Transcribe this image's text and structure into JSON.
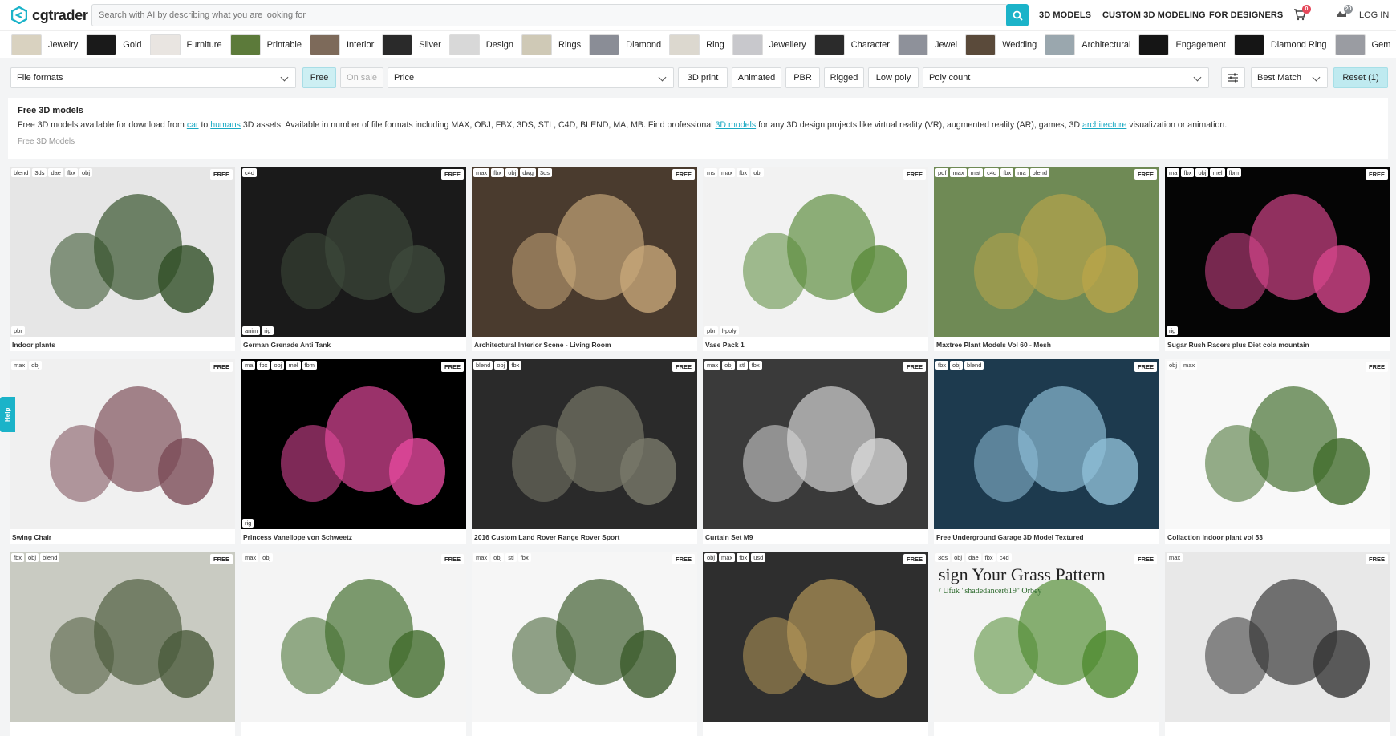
{
  "brand": {
    "name": "cgtrader"
  },
  "search": {
    "placeholder": "Search with AI by describing what you are looking for"
  },
  "topnav": {
    "models": "3D MODELS",
    "custom": "CUSTOM 3D MODELING",
    "designers": "FOR DESIGNERS",
    "cart_count": "0",
    "wish_count": "20",
    "login": "LOG IN"
  },
  "categories": [
    {
      "label": "Jewelry",
      "color": "#d9d2c0"
    },
    {
      "label": "Gold",
      "color": "#1a1a1a"
    },
    {
      "label": "Furniture",
      "color": "#e9e5e1"
    },
    {
      "label": "Printable",
      "color": "#5c7a3a"
    },
    {
      "label": "Interior",
      "color": "#7d6a5a"
    },
    {
      "label": "Silver",
      "color": "#2a2a2a"
    },
    {
      "label": "Design",
      "color": "#d8d8d8"
    },
    {
      "label": "Rings",
      "color": "#cfc9b6"
    },
    {
      "label": "Diamond",
      "color": "#8a8d96"
    },
    {
      "label": "Ring",
      "color": "#dcd8cf"
    },
    {
      "label": "Jewellery",
      "color": "#c8c8cc"
    },
    {
      "label": "Character",
      "color": "#2b2b2b"
    },
    {
      "label": "Jewel",
      "color": "#8e919a"
    },
    {
      "label": "Wedding",
      "color": "#5a4a3a"
    },
    {
      "label": "Architectural",
      "color": "#9aa7ae"
    },
    {
      "label": "Engagement",
      "color": "#151515"
    },
    {
      "label": "Diamond Ring",
      "color": "#151515"
    },
    {
      "label": "Gem",
      "color": "#9a9ca2"
    }
  ],
  "filters": {
    "file_formats": "File formats",
    "free": "Free",
    "on_sale": "On sale",
    "price": "Price",
    "print": "3D print",
    "animated": "Animated",
    "pbr": "PBR",
    "rigged": "Rigged",
    "low_poly": "Low poly",
    "poly_count": "Poly count",
    "sort": "Best Match",
    "reset": "Reset (1)"
  },
  "description": {
    "title": "Free 3D models",
    "text_1": "Free 3D models available for download from ",
    "link_car": "car",
    "text_2": " to ",
    "link_humans": "humans",
    "text_3": " 3D assets. Available in number of file formats including MAX, OBJ, FBX, 3DS, STL, C4D, BLEND, MA, MB. Find professional ",
    "link_models": "3D models",
    "text_4": " for any 3D design projects like virtual reality (VR), augmented reality (AR), games, 3D ",
    "link_arch": "architecture",
    "text_5": " visualization or animation.",
    "breadcrumb": "Free 3D Models"
  },
  "free_label": "FREE",
  "help_label": "Help",
  "cards": [
    {
      "title": "Indoor plants",
      "tags": [
        "blend",
        "3ds",
        "dae",
        "fbx",
        "obj"
      ],
      "btags": [
        "pbr"
      ],
      "bg": "#e6e6e6",
      "fg": "#2f4d25"
    },
    {
      "title": "German Grenade Anti Tank",
      "tags": [
        "c4d"
      ],
      "btags": [
        "anim",
        "rig"
      ],
      "bg": "#1a1a1a",
      "fg": "#3e4a3b"
    },
    {
      "title": "Architectural Interior Scene - Living Room",
      "tags": [
        "max",
        "fbx",
        "obj",
        "dwg",
        "3ds"
      ],
      "btags": [],
      "bg": "#4a3b2e",
      "fg": "#c8a87a"
    },
    {
      "title": "Vase Pack 1",
      "tags": [
        "ms",
        "max",
        "fbx",
        "obj"
      ],
      "btags": [
        "pbr",
        "l-poly"
      ],
      "bg": "#f2f2f2",
      "fg": "#5a8a3a"
    },
    {
      "title": "Maxtree Plant Models Vol 60 - Mesh",
      "tags": [
        "pdf",
        "max",
        "mat",
        "c4d",
        "fbx",
        "ma",
        "blend"
      ],
      "btags": [],
      "bg": "#6f8a55",
      "fg": "#b9a54a"
    },
    {
      "title": "Sugar Rush Racers plus Diet cola mountain",
      "tags": [
        "ma",
        "fbx",
        "obj",
        "mel",
        "fbm"
      ],
      "btags": [
        "rig"
      ],
      "bg": "#050505",
      "fg": "#d6468c"
    },
    {
      "title": "Swing Chair",
      "tags": [
        "max",
        "obj"
      ],
      "btags": [],
      "bg": "#f0f0f0",
      "fg": "#7a4a55"
    },
    {
      "title": "Princess Vanellope von Schweetz",
      "tags": [
        "ma",
        "fbx",
        "obj",
        "mel",
        "fbm"
      ],
      "btags": [
        "rig"
      ],
      "bg": "#000000",
      "fg": "#e64a9e"
    },
    {
      "title": "2016 Custom Land Rover Range Rover Sport",
      "tags": [
        "blend",
        "obj",
        "fbx"
      ],
      "btags": [],
      "bg": "#2a2a2a",
      "fg": "#7a7a6a"
    },
    {
      "title": "Curtain Set M9",
      "tags": [
        "max",
        "obj",
        "stl",
        "fbx"
      ],
      "btags": [],
      "bg": "#3a3a3a",
      "fg": "#d8d8d8"
    },
    {
      "title": "Free Underground Garage 3D Model Textured",
      "tags": [
        "fbx",
        "obj",
        "blend"
      ],
      "btags": [],
      "bg": "#1d3a4e",
      "fg": "#8fbfd8"
    },
    {
      "title": "Collaction Indoor plant vol 53",
      "tags": [
        "obj",
        "max"
      ],
      "btags": [],
      "bg": "#f8f8f8",
      "fg": "#3f6b2a"
    },
    {
      "title": "",
      "tags": [
        "fbx",
        "obj",
        "blend"
      ],
      "btags": [],
      "bg": "#c9cbc2",
      "fg": "#4a5a3a"
    },
    {
      "title": "",
      "tags": [
        "max",
        "obj"
      ],
      "btags": [],
      "bg": "#f4f4f4",
      "fg": "#3f6b2a"
    },
    {
      "title": "",
      "tags": [
        "max",
        "obj",
        "stl",
        "fbx"
      ],
      "btags": [],
      "bg": "#f6f6f6",
      "fg": "#3a5a2a"
    },
    {
      "title": "",
      "tags": [
        "obj",
        "max",
        "fbx",
        "usd"
      ],
      "btags": [],
      "bg": "#2e2e2e",
      "fg": "#b89a5a"
    },
    {
      "title": "",
      "tags": [
        "3ds",
        "obj",
        "dae",
        "fbx",
        "c4d"
      ],
      "btags": [],
      "bg": "#f4f4f4",
      "fg": "#4f8a2f",
      "caption": "sign Your Grass Pattern",
      "subcaption": "/ Ufuk \"shadedancer619\" Orbey"
    },
    {
      "title": "",
      "tags": [
        "max"
      ],
      "btags": [],
      "bg": "#e8e8e8",
      "fg": "#333333"
    }
  ]
}
